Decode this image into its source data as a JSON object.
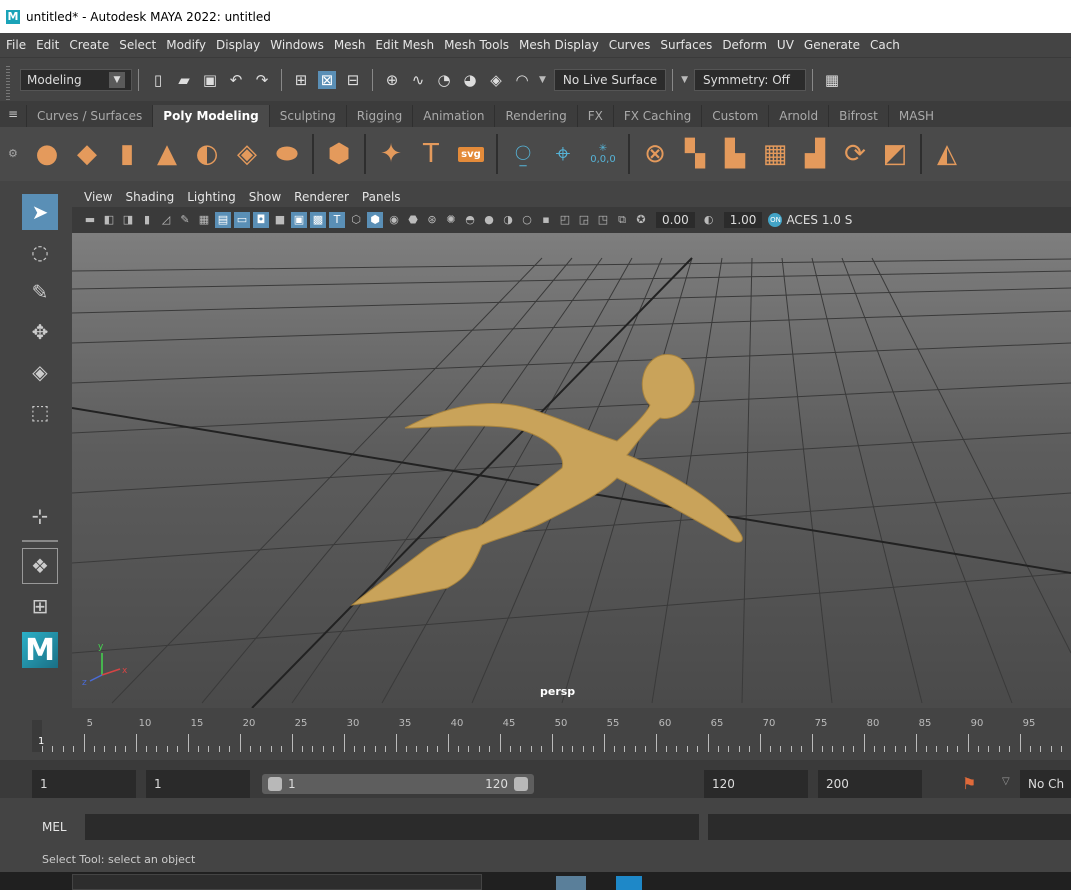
{
  "window": {
    "title": "untitled* - Autodesk MAYA 2022: untitled",
    "logo": "M"
  },
  "menus": [
    "File",
    "Edit",
    "Create",
    "Select",
    "Modify",
    "Display",
    "Windows",
    "Mesh",
    "Edit Mesh",
    "Mesh Tools",
    "Mesh Display",
    "Curves",
    "Surfaces",
    "Deform",
    "UV",
    "Generate",
    "Cach"
  ],
  "status": {
    "mode": "Modeling",
    "live_surface": "No Live Surface",
    "symmetry": "Symmetry: Off"
  },
  "shelf": {
    "tabs": [
      "Curves / Surfaces",
      "Poly Modeling",
      "Sculpting",
      "Rigging",
      "Animation",
      "Rendering",
      "FX",
      "FX Caching",
      "Custom",
      "Arnold",
      "Bifrost",
      "MASH"
    ],
    "active": "Poly Modeling",
    "svg_label": "svg",
    "text_label": "T",
    "zero_label": "0,0,0"
  },
  "panel": {
    "menus": [
      "View",
      "Shading",
      "Lighting",
      "Show",
      "Renderer",
      "Panels"
    ],
    "exposure": "0.00",
    "gamma": "1.00",
    "colorspace": "ACES 1.0 S",
    "camera": "persp"
  },
  "timeline": {
    "ticks": [
      "5",
      "10",
      "15",
      "20",
      "25",
      "30",
      "35",
      "40",
      "45",
      "50",
      "55",
      "60",
      "65",
      "70",
      "75",
      "80",
      "85",
      "90",
      "95"
    ],
    "current": "1"
  },
  "range": {
    "start": "1",
    "anim_start": "1",
    "slider_start": "1",
    "slider_end": "120",
    "end": "120",
    "anim_end": "200",
    "char_set": "No Ch"
  },
  "command": {
    "lang": "MEL",
    "help": "Select Tool: select an object"
  },
  "colors": {
    "mesh": "#c9a35a",
    "accent": "#5a8fb6",
    "shelf_icon": "#e49a5c"
  }
}
